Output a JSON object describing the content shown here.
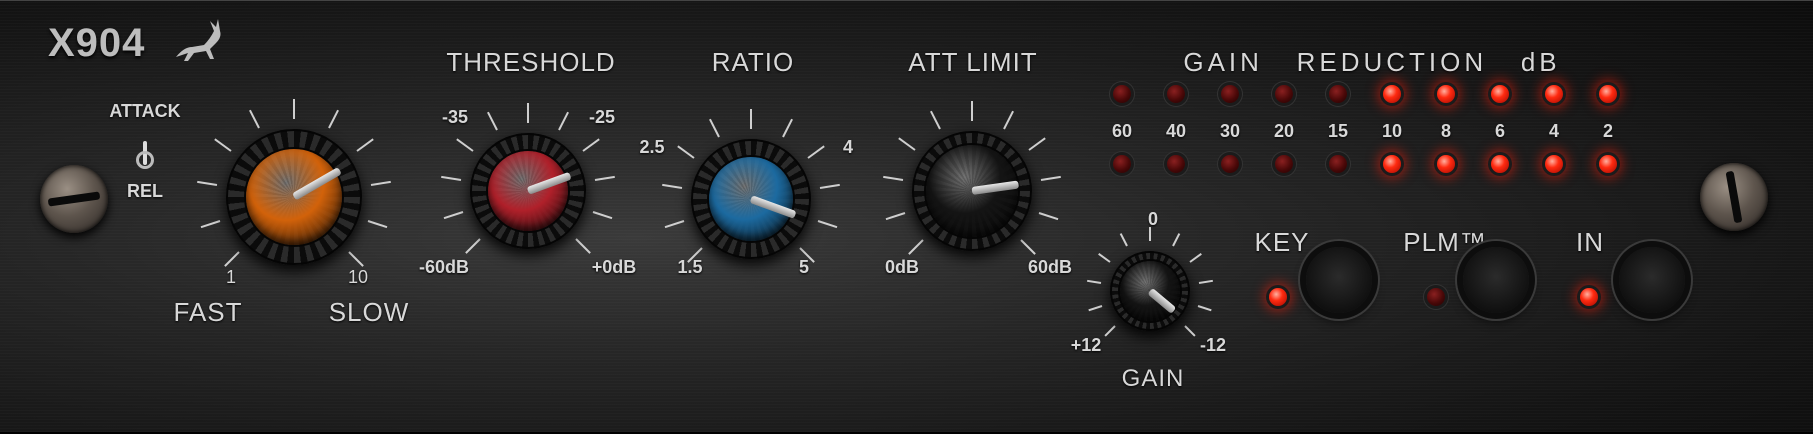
{
  "brand": {
    "model": "X904",
    "logo": "antelope-icon"
  },
  "attack_release": {
    "top_label": "ATTACK",
    "bottom_label": "REL",
    "position": "attack"
  },
  "attack_knob": {
    "min_label": "1",
    "max_label": "10",
    "left_caption": "FAST",
    "right_caption": "SLOW",
    "cap_color": "#d2620a"
  },
  "threshold": {
    "title": "THRESHOLD",
    "tick_labels": [
      "-35",
      "-25",
      "-60dB",
      "+0dB"
    ],
    "cap_color": "#b0202a"
  },
  "ratio": {
    "title": "RATIO",
    "tick_labels": [
      "2.5",
      "4",
      "1.5",
      "5"
    ],
    "cap_color": "#1c6aa0"
  },
  "att_limit": {
    "title": "ATT LIMIT",
    "tick_labels": [
      "0dB",
      "60dB"
    ],
    "cap_color": "#141414"
  },
  "gain": {
    "title": "GAIN",
    "tick_labels": [
      "0",
      "+12",
      "-12"
    ]
  },
  "meter": {
    "title": "GAIN   REDUCTION   dB",
    "scale": [
      "60",
      "40",
      "30",
      "20",
      "15",
      "10",
      "8",
      "6",
      "4",
      "2"
    ],
    "top_row_lit": [
      false,
      false,
      false,
      false,
      false,
      true,
      true,
      true,
      true,
      true
    ],
    "bottom_row_lit": [
      false,
      false,
      false,
      false,
      false,
      true,
      true,
      true,
      true,
      true
    ]
  },
  "buttons": {
    "key_label": "KEY",
    "key_led_on": true,
    "plm_label": "PLM™",
    "plm_led_on": false,
    "in_label": "IN",
    "in_led_on": true
  },
  "colors": {
    "led_on": "#ff2a10",
    "led_off": "#4a0808",
    "label": "#d8d8d8"
  }
}
